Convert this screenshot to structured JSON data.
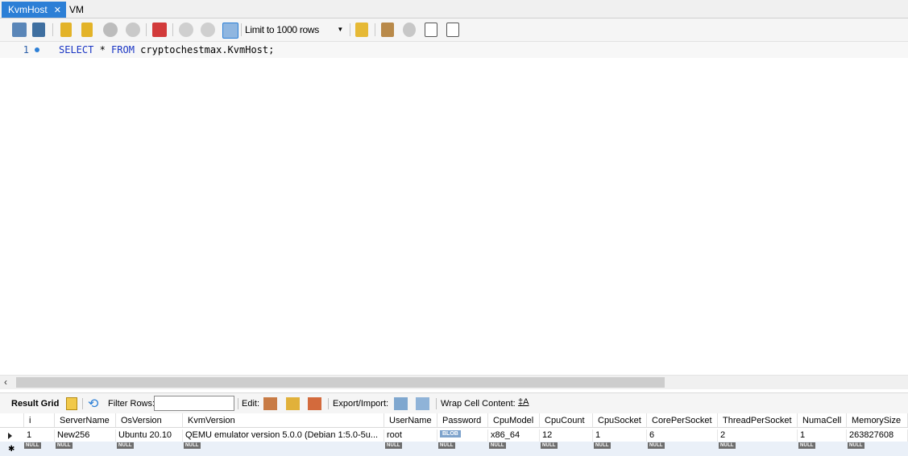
{
  "tabs": [
    {
      "label": "KvmHost",
      "active": true
    },
    {
      "label": "VM",
      "active": false
    }
  ],
  "toolbar": {
    "limit_label": "Limit to 1000 rows"
  },
  "editor": {
    "line_number": "1",
    "sql_kw1": "SELECT",
    "sql_mid": " * ",
    "sql_kw2": "FROM",
    "sql_rest": " cryptochestmax.KvmHost;"
  },
  "result_toolbar": {
    "result_grid": "Result Grid",
    "filter_rows": "Filter Rows:",
    "filter_value": "",
    "edit": "Edit:",
    "export_import": "Export/Import:",
    "wrap_cell": "Wrap Cell Content:"
  },
  "grid": {
    "columns": [
      "i",
      "ServerName",
      "OsVersion",
      "KvmVersion",
      "UserName",
      "Password",
      "CpuModel",
      "CpuCount",
      "CpuSocket",
      "CorePerSocket",
      "ThreadPerSocket",
      "NumaCell",
      "MemorySize"
    ],
    "row": [
      "1",
      "New256",
      "Ubuntu 20.10",
      "QEMU emulator version 5.0.0 (Debian 1:5.0-5u...",
      "root",
      "",
      "x86_64",
      "12",
      "1",
      "6",
      "2",
      "1",
      "263827608"
    ],
    "blob_label": "BLOB",
    "null_label": "NULL"
  },
  "colors": {
    "accent": "#2c7fd6",
    "keyword": "#1a35c4"
  }
}
